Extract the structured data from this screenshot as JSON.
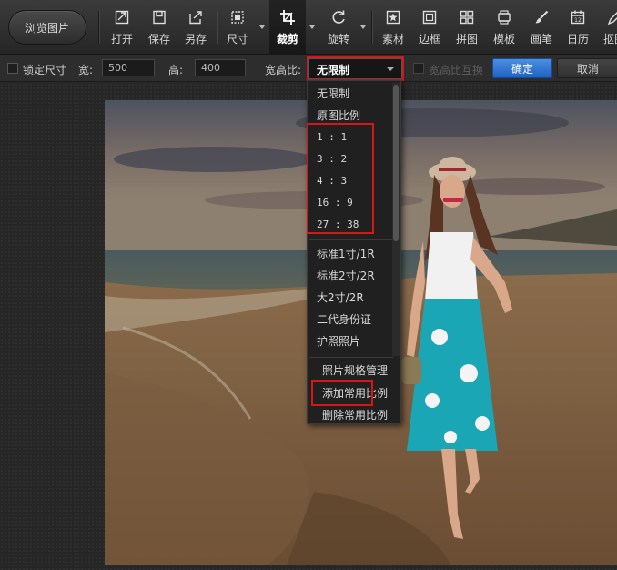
{
  "toolbar": {
    "browse_label": "浏览图片",
    "tools": [
      {
        "label": "打开",
        "icon": "open-file-icon"
      },
      {
        "label": "保存",
        "icon": "save-icon"
      },
      {
        "label": "另存",
        "icon": "save-as-icon"
      },
      {
        "label": "尺寸",
        "icon": "resize-icon"
      },
      {
        "label": "裁剪",
        "icon": "crop-icon",
        "active": true
      },
      {
        "label": "旋转",
        "icon": "rotate-icon"
      },
      {
        "label": "素材",
        "icon": "sticker-icon"
      },
      {
        "label": "边框",
        "icon": "frame-icon"
      },
      {
        "label": "拼图",
        "icon": "collage-icon"
      },
      {
        "label": "模板",
        "icon": "template-icon"
      },
      {
        "label": "画笔",
        "icon": "brush-icon"
      },
      {
        "label": "日历",
        "icon": "calendar-icon"
      },
      {
        "label": "抠图",
        "icon": "cutout-icon"
      }
    ]
  },
  "options": {
    "lock_size_label": "锁定尺寸",
    "width_label": "宽:",
    "width_value": "500",
    "height_label": "高:",
    "height_value": "400",
    "ratio_label": "宽高比:",
    "ratio_value": "无限制",
    "swap_label": "宽高比互换",
    "confirm_label": "确定",
    "cancel_label": "取消"
  },
  "dropdown": {
    "items": [
      "无限制",
      "原图比例",
      "1 : 1",
      "3 : 2",
      "4 : 3",
      "16 : 9",
      "27 : 38",
      "标准1寸/1R",
      "标准2寸/2R",
      "大2寸/2R",
      "二代身份证",
      "护照照片"
    ],
    "manage_label": "照片规格管理",
    "add_label": "添加常用比例",
    "delete_label": "删除常用比例"
  },
  "colors": {
    "highlight_red": "#d5161a",
    "confirm_blue": "#2a70d0"
  }
}
